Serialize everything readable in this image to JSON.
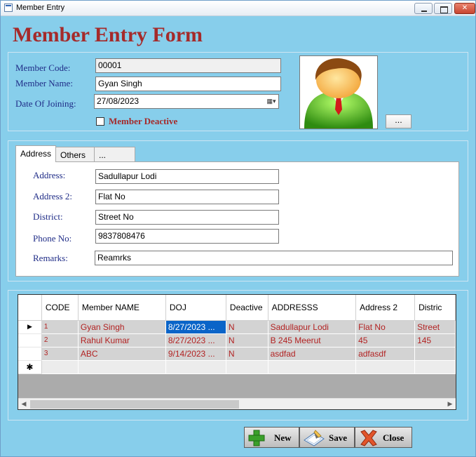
{
  "window": {
    "title": "Member Entry"
  },
  "header": {
    "form_title": "Member Entry Form"
  },
  "member": {
    "code_label": "Member Code:",
    "code_value": "00001",
    "name_label": "Member Name:",
    "name_value": "Gyan Singh",
    "doj_label": "Date Of Joining:",
    "doj_value": "27/08/2023",
    "deactive_label": "Member Deactive",
    "deactive_checked": false,
    "browse_label": "..."
  },
  "tabs": [
    {
      "label": "Address",
      "active": true
    },
    {
      "label": "Others",
      "active": false
    },
    {
      "label": "...",
      "active": false
    }
  ],
  "address": {
    "address_label": "Address:",
    "address_value": "Sadullapur Lodi",
    "address2_label": "Address 2:",
    "address2_value": "Flat No",
    "district_label": "District:",
    "district_value": "Street No",
    "phone_label": "Phone No:",
    "phone_value": "9837808476",
    "remarks_label": "Remarks:",
    "remarks_value": "Reamrks"
  },
  "grid": {
    "columns": [
      "CODE",
      "Member NAME",
      "DOJ",
      "Deactive",
      "ADDRESSS",
      "Address 2",
      "Distric"
    ],
    "rows": [
      [
        "1",
        "Gyan Singh",
        "8/27/2023 ...",
        "N",
        "Sadullapur Lodi",
        "Flat No",
        "Street"
      ],
      [
        "2",
        "Rahul Kumar",
        "8/27/2023 ...",
        "N",
        "B 245 Meerut",
        "45",
        "145"
      ],
      [
        "3",
        "ABC",
        "9/14/2023 ...",
        "N",
        "asdfad",
        "adfasdf",
        ""
      ]
    ],
    "current_row_marker": "▶",
    "new_row_marker": "✱"
  },
  "buttons": {
    "new": "New",
    "save": "Save",
    "close": "Close"
  },
  "colors": {
    "form_background": "#87ceeb",
    "title_color": "#a52a2a",
    "label_color": "#1f2c87",
    "grid_text": "#b22222",
    "selection": "#0a64c8"
  }
}
